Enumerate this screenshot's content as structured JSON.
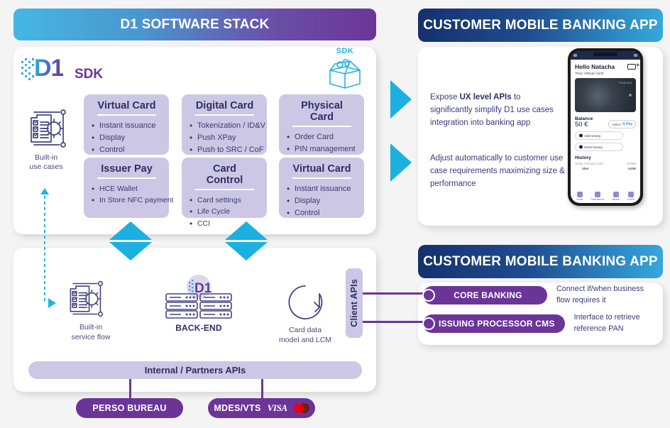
{
  "headers": {
    "stack": "D1 SOFTWARE STACK",
    "app_top": "CUSTOMER MOBILE BANKING APP",
    "app_bottom": "CUSTOMER MOBILE BANKING APP"
  },
  "sdk_panel": {
    "logo_text": "D1",
    "logo_suffix": "SDK",
    "box_label": "SDK",
    "builtin": {
      "line1": "Built-in",
      "line2": "use cases"
    },
    "cards": [
      {
        "title": "Virtual Card",
        "items": [
          "Instant issuance",
          "Display",
          "Control"
        ]
      },
      {
        "title": "Digital Card",
        "items": [
          "Tokenization / ID&V",
          "Push XPay",
          "Push to SRC / CoF"
        ]
      },
      {
        "title": "Physical Card",
        "items": [
          "Order Card",
          "PIN management"
        ]
      },
      {
        "title": "Issuer Pay",
        "items": [
          "HCE Wallet",
          "In Store NFC payment"
        ]
      },
      {
        "title": "Card Control",
        "items": [
          "Card settings",
          "Life Cycle",
          "CCI"
        ]
      },
      {
        "title": "Virtual Card",
        "items": [
          "Instant issuance",
          "Display",
          "Control"
        ]
      }
    ]
  },
  "backend_panel": {
    "nodes": [
      {
        "line1": "Built-in",
        "line2": "service flow",
        "bold": false
      },
      {
        "line1": "BACK-END",
        "line2": "",
        "bold": true
      },
      {
        "line1": "Card data",
        "line2": "model and LCM",
        "bold": false
      }
    ],
    "client_apis": "Client APIs",
    "internal_apis": "Internal / Partners APIs",
    "partners": [
      {
        "label": "PERSO BUREAU",
        "marks": false
      },
      {
        "label": "MDES/VTS",
        "marks": true,
        "visa": "VISA"
      }
    ]
  },
  "app_panel": {
    "desc_1_pre": "Expose ",
    "desc_1_bold": "UX level APIs",
    "desc_1_post": " to significantly simplify D1 use cases integration into banking app",
    "desc_2": "Adjust automatically to customer use case requirements maximizing size & performance",
    "phone": {
      "greeting": "Hello Natacha",
      "subtitle": "Your virtual card",
      "card_brand": "THALES",
      "balance_label": "Balance",
      "balance_value": "50 €",
      "gpay_label": "Add to",
      "gpay_brand": "G Pay",
      "btn_add": "Add money",
      "btn_send": "Send money",
      "history_label": "History",
      "history_rows": [
        {
          "name": "Today, February 23rd",
          "amount": "-40,99€"
        },
        {
          "name": "Uber",
          "amount": "-9,99€"
        }
      ],
      "nav": [
        "Home",
        "Transactions",
        "Wallets",
        "Profile"
      ]
    }
  },
  "connections": {
    "rows": [
      {
        "pill": "CORE BANKING",
        "desc": "Connect if/when business flow requires it"
      },
      {
        "pill": "ISSUING PROCESSOR CMS",
        "desc": "Interface to retrieve reference PAN"
      }
    ]
  },
  "colors": {
    "cyan": "#1bb0e0",
    "purple": "#6b3598",
    "lavender": "#cdc7e6",
    "navy": "#2f2e62",
    "dark_blue": "#15306e"
  }
}
